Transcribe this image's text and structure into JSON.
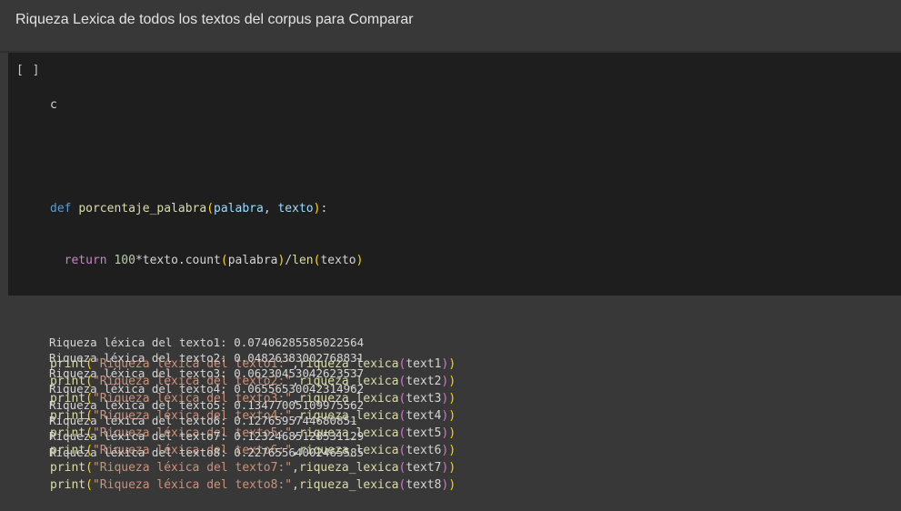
{
  "text_cell": {
    "heading": "Riqueza Lexica de todos los textos del corpus para Comparar"
  },
  "code_cell": {
    "run_label": "[ ]",
    "line1": "c",
    "def_kw": "def",
    "func_name": "porcentaje_palabra",
    "param_palabra": "palabra",
    "param_texto": "texto",
    "return_kw": "return",
    "number": "100",
    "texto_var": "texto",
    "count_method": ".count",
    "palabra_arg": "palabra",
    "div": "/",
    "len_fn": "len",
    "texto_arg": "texto",
    "print_fn": "print",
    "riqueza_fn": "riqueza_lexica",
    "prints": [
      {
        "str": "\"Riqueza léxica del texto1:\"",
        "arg": "text1"
      },
      {
        "str": "\"Riqueza léxica del texto2:\"",
        "arg": "text2"
      },
      {
        "str": "\"Riqueza léxica del texto3:\"",
        "arg": "text3"
      },
      {
        "str": "\"Riqueza léxica del texto4:\"",
        "arg": "text4"
      },
      {
        "str": "\"Riqueza léxica del texto5:\"",
        "arg": "text5"
      },
      {
        "str": "\"Riqueza léxica del texto6:\"",
        "arg": "text6"
      },
      {
        "str": "\"Riqueza léxica del texto7:\"",
        "arg": "text7"
      },
      {
        "str": "\"Riqueza léxica del texto8:\"",
        "arg": "text8"
      }
    ]
  },
  "output": {
    "lines": [
      "Riqueza léxica del texto1: 0.07406285585022564",
      "Riqueza léxica del texto2: 0.04826383002768831",
      "Riqueza léxica del texto3: 0.06230453042623537",
      "Riqueza léxica del texto4: 0.06556530042314962",
      "Riqueza léxica del texto5: 0.13477005109975562",
      "Riqueza léxica del texto6: 0.1276595744680851",
      "Riqueza léxica del texto7: 0.12324685128531129",
      "Riqueza léxica del texto8: 0.22765564002465585"
    ]
  }
}
